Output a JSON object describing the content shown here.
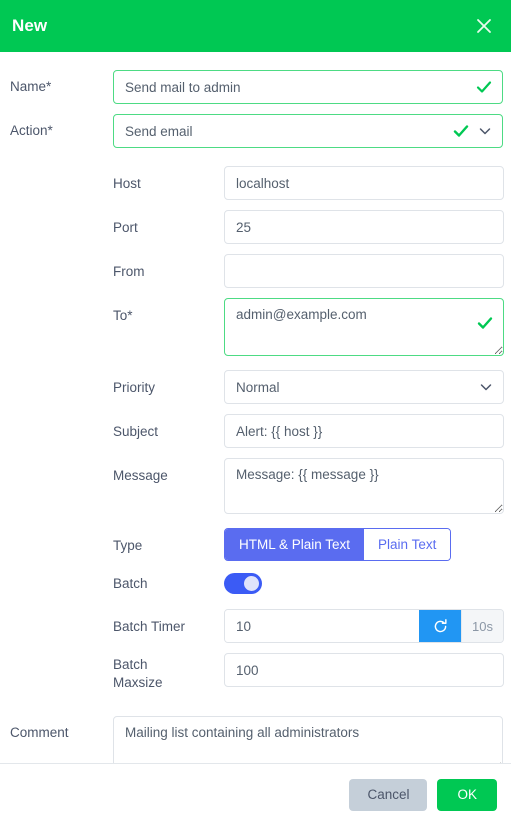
{
  "header": {
    "title": "New",
    "close_icon": "close-icon",
    "bg_color": "#00c853"
  },
  "form": {
    "name": {
      "label": "Name*",
      "value": "Send mail to admin",
      "valid": true
    },
    "action": {
      "label": "Action*",
      "value": "Send email",
      "valid": true,
      "options": [
        "Send email"
      ]
    },
    "host": {
      "label": "Host",
      "value": "localhost"
    },
    "port": {
      "label": "Port",
      "value": "25"
    },
    "from": {
      "label": "From",
      "value": ""
    },
    "to": {
      "label": "To*",
      "value": "admin@example.com",
      "valid": true
    },
    "priority": {
      "label": "Priority",
      "value": "Normal",
      "options": [
        "Normal"
      ]
    },
    "subject": {
      "label": "Subject",
      "value": "Alert: {{ host }}"
    },
    "message": {
      "label": "Message",
      "value": "Message: {{ message }}"
    },
    "type": {
      "label": "Type",
      "options": [
        {
          "label": "HTML & Plain Text",
          "active": true
        },
        {
          "label": "Plain Text",
          "active": false
        }
      ]
    },
    "batch": {
      "label": "Batch",
      "enabled": true
    },
    "batch_timer": {
      "label": "Batch Timer",
      "value": "10",
      "suffix": "10s",
      "refresh_icon": "refresh-icon"
    },
    "batch_maxsize": {
      "label": "Batch Maxsize",
      "value": "100"
    },
    "comment": {
      "label": "Comment",
      "value": "Mailing list containing all administrators"
    }
  },
  "footer": {
    "cancel_label": "Cancel",
    "ok_label": "OK"
  },
  "colors": {
    "accent_green": "#00c853",
    "valid_green": "#4ddb84",
    "toggle_blue": "#5a6cf0",
    "refresh_blue": "#2196f3",
    "cancel_gray": "#c5cfd9"
  }
}
